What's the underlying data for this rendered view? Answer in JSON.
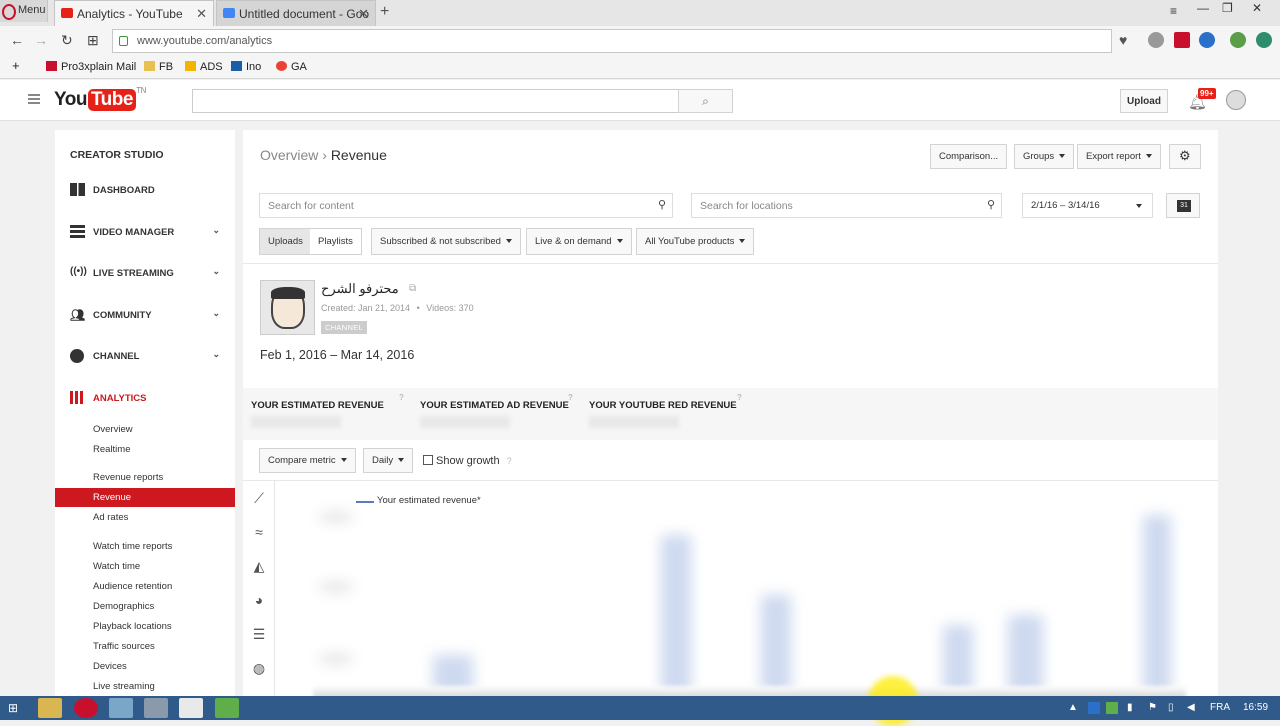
{
  "browser": {
    "menu_label": "Menu",
    "tabs": [
      {
        "title": "Analytics - YouTube",
        "active": true,
        "favicon_color": "#e62117"
      },
      {
        "title": "Untitled document - Goo",
        "active": false,
        "favicon_color": "#4285f4"
      }
    ],
    "url": "www.youtube.com/analytics",
    "bookmarks": [
      {
        "label": "Pro3xplain Mail",
        "icon": "gmail-icon"
      },
      {
        "label": "FB",
        "icon": "folder-icon"
      },
      {
        "label": "ADS",
        "icon": "adsense-icon"
      },
      {
        "label": "Ino",
        "icon": "inoreader-icon"
      },
      {
        "label": "GA",
        "icon": "google-icon"
      }
    ]
  },
  "header": {
    "logo_you": "You",
    "logo_tube": "Tube",
    "logo_region": "TN",
    "upload_label": "Upload",
    "notification_count": "99+"
  },
  "sidebar": {
    "title": "CREATOR STUDIO",
    "items": [
      {
        "label": "DASHBOARD"
      },
      {
        "label": "VIDEO MANAGER"
      },
      {
        "label": "LIVE STREAMING"
      },
      {
        "label": "COMMUNITY"
      },
      {
        "label": "CHANNEL"
      },
      {
        "label": "ANALYTICS"
      }
    ],
    "analytics_items": [
      "Overview",
      "Realtime",
      "Revenue reports",
      "Revenue",
      "Ad rates",
      "Watch time reports",
      "Watch time",
      "Audience retention",
      "Demographics",
      "Playback locations",
      "Traffic sources",
      "Devices",
      "Live streaming"
    ]
  },
  "main": {
    "breadcrumb_parent": "Overview",
    "breadcrumb_sep": "›",
    "breadcrumb_current": "Revenue",
    "comparison_label": "Comparison...",
    "groups_label": "Groups",
    "export_label": "Export report",
    "search_content_placeholder": "Search for content",
    "search_locations_placeholder": "Search for locations",
    "date_range": "2/1/16 – 3/14/16",
    "calendar_label": "31",
    "filters": {
      "uploads": "Uploads",
      "playlists": "Playlists",
      "subscribed": "Subscribed & not subscribed",
      "live": "Live & on demand",
      "products": "All YouTube products"
    },
    "channel": {
      "name": "محترفو الشرح",
      "created": "Created: Jan 21, 2014",
      "videos": "Videos: 370",
      "badge": "CHANNEL"
    },
    "period": "Feb 1, 2016 – Mar 14, 2016",
    "metrics": [
      "YOUR ESTIMATED REVENUE",
      "YOUR ESTIMATED AD REVENUE",
      "YOUR YOUTUBE RED REVENUE"
    ],
    "compare_metric": "Compare metric",
    "interval": "Daily",
    "show_growth": "Show growth",
    "legend": "Your estimated revenue*"
  },
  "taskbar": {
    "language": "FRA",
    "time": "16:59"
  }
}
